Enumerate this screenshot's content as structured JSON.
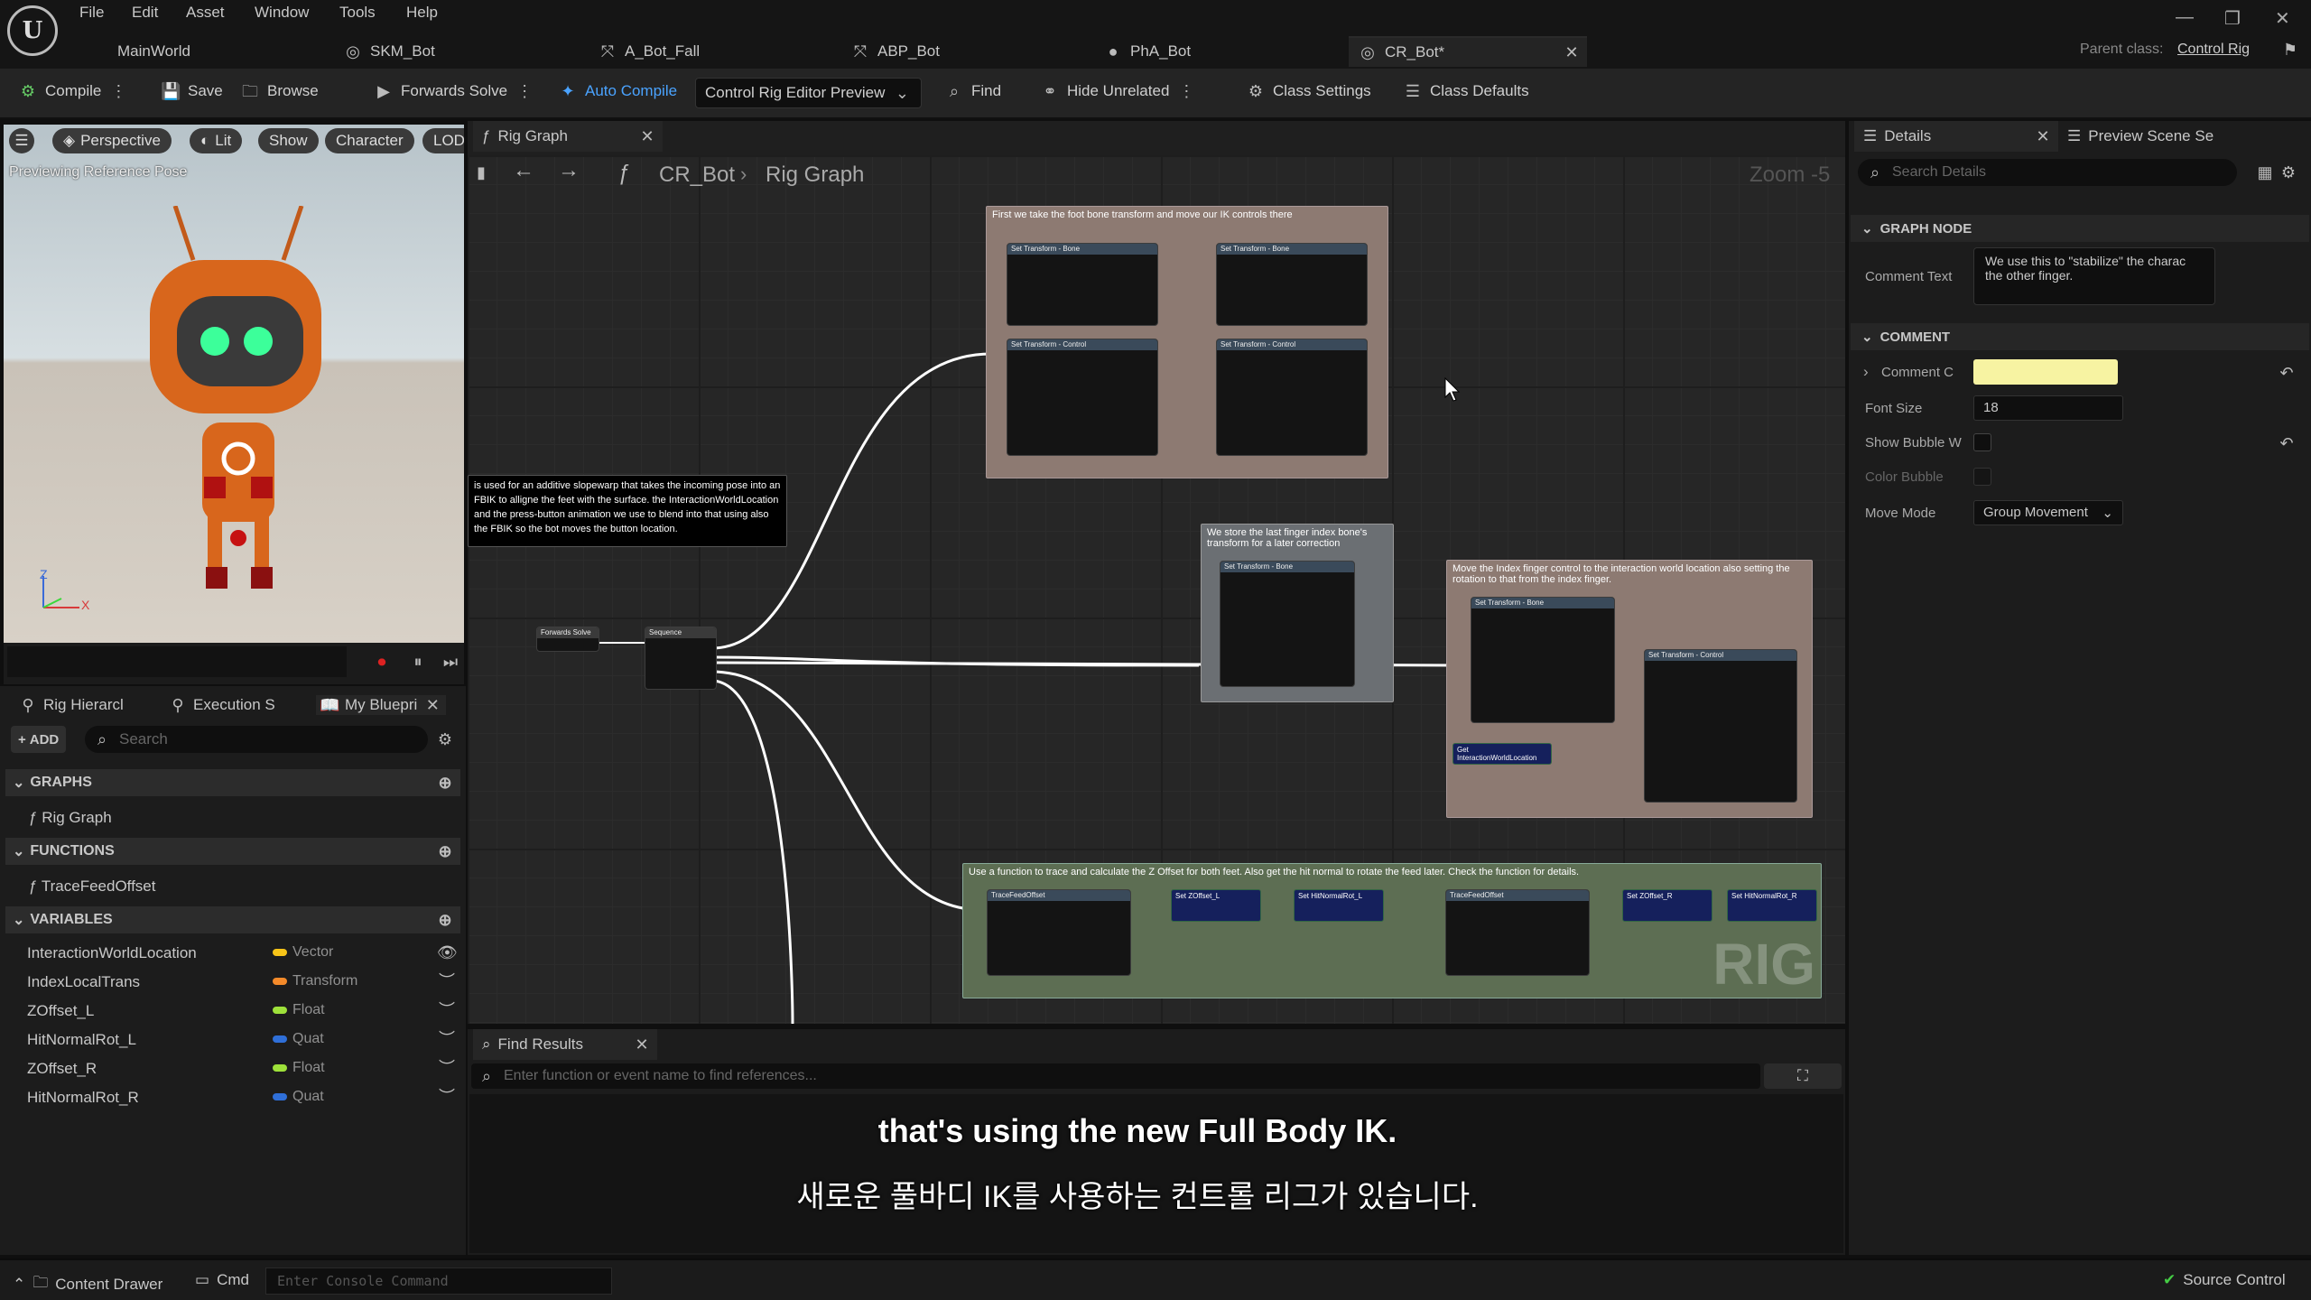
{
  "menu": [
    "File",
    "Edit",
    "Asset",
    "Window",
    "Tools",
    "Help"
  ],
  "tabs": [
    {
      "label": "MainWorld"
    },
    {
      "label": "SKM_Bot"
    },
    {
      "label": "A_Bot_Fall"
    },
    {
      "label": "ABP_Bot"
    },
    {
      "label": "PhA_Bot"
    },
    {
      "label": "CR_Bot*"
    }
  ],
  "parent_class": {
    "label": "Parent class:",
    "value": "Control Rig"
  },
  "toolbar": {
    "compile": "Compile",
    "save": "Save",
    "browse": "Browse",
    "forwards_solve": "Forwards Solve",
    "auto_compile": "Auto Compile",
    "preview_mode": "Control Rig Editor Preview",
    "find": "Find",
    "hide_unrelated": "Hide Unrelated",
    "class_settings": "Class Settings",
    "class_defaults": "Class Defaults"
  },
  "viewport": {
    "perspective": "Perspective",
    "lit": "Lit",
    "show": "Show",
    "character": "Character",
    "lod": "LOD",
    "caption": "Previewing Reference Pose",
    "axis_z": "Z",
    "axis_x": "X"
  },
  "left_tabs": [
    "Rig Hierarcl",
    "Execution S",
    "My Bluepri"
  ],
  "add_label": "ADD",
  "search_placeholder": "Search",
  "sections": {
    "graphs": "GRAPHS",
    "functions": "FUNCTIONS",
    "variables": "VARIABLES"
  },
  "graphs": [
    "Rig Graph"
  ],
  "functions": [
    "TraceFeedOffset"
  ],
  "variables": [
    {
      "name": "InteractionWorldLocation",
      "type": "Vector",
      "color": "#f7c418"
    },
    {
      "name": "IndexLocalTrans",
      "type": "Transform",
      "color": "#f48a2a"
    },
    {
      "name": "ZOffset_L",
      "type": "Float",
      "color": "#9ee13a"
    },
    {
      "name": "HitNormalRot_L",
      "type": "Quat",
      "color": "#2f6fd8"
    },
    {
      "name": "ZOffset_R",
      "type": "Float",
      "color": "#9ee13a"
    },
    {
      "name": "HitNormalRot_R",
      "type": "Quat",
      "color": "#2f6fd8"
    }
  ],
  "graph": {
    "tab": "Rig Graph",
    "crumb_root": "CR_Bot",
    "crumb_leaf": "Rig Graph",
    "zoom": "Zoom -5",
    "comments": {
      "c1": "First we take the foot bone transform and move our IK controls there",
      "c2": "is used for an additive slopewarp that takes the incoming pose into an FBIK to alligne the feet with the surface. the InteractionWorldLocation and the press-button animation we use to blend into that using also the FBIK so the bot moves the button location.",
      "c3": "We store the last finger index bone's transform for a later correction",
      "c4": "Move the Index finger control to the interaction world location also setting the rotation to that from the index finger.",
      "c5": "Use a function to trace and calculate the Z Offset for both feet. Also get the hit normal to rotate the feed later. Check the function for details."
    },
    "watermark": "RIG"
  },
  "find_results": {
    "tab": "Find Results",
    "placeholder": "Enter function or event name to find references..."
  },
  "subtitles": {
    "en": "that's using the new Full Body IK.",
    "ko": "새로운 풀바디 IK를 사용하는 컨트롤 리그가 있습니다."
  },
  "details": {
    "tab1": "Details",
    "tab2": "Preview Scene Se",
    "search_placeholder": "Search Details",
    "graph_node": "GRAPH NODE",
    "comment_text_label": "Comment Text",
    "comment_text_value": "We use this to \"stabilize\" the charac the other finger.",
    "comment": "COMMENT",
    "comment_color_label": "Comment C",
    "comment_color": "#f7f3a2",
    "font_size_label": "Font Size",
    "font_size": "18",
    "show_bubble_label": "Show Bubble W",
    "color_bubble_label": "Color Bubble",
    "move_mode_label": "Move Mode",
    "move_mode": "Group Movement"
  },
  "status": {
    "content_drawer": "Content Drawer",
    "cmd": "Cmd",
    "console_placeholder": "Enter Console Command",
    "source_control": "Source Control"
  }
}
